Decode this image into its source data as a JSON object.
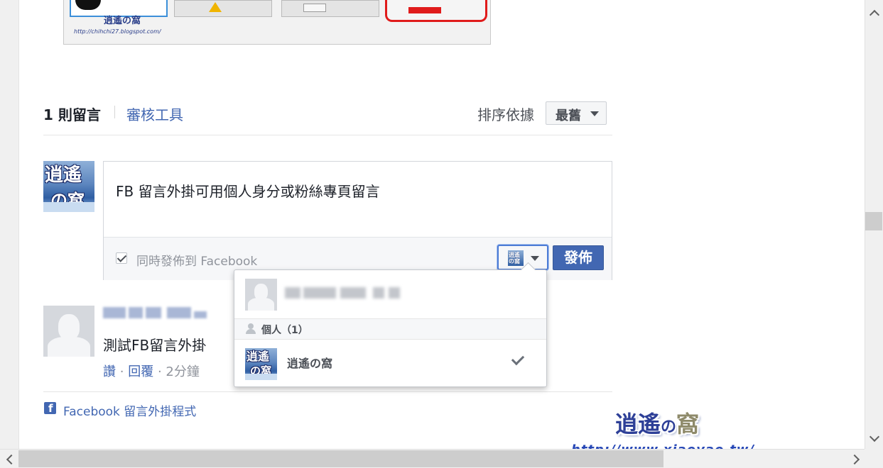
{
  "top_thumbnail": {
    "logo_text": "逍遙の窩",
    "url_text": "http://chihchi27.blogspot.com/"
  },
  "comments_header": {
    "count_label": "1 則留言",
    "moderation_link": "審核工具",
    "sort_label": "排序依據",
    "sort_value": "最舊"
  },
  "composer": {
    "avatar_line1": "逍遙",
    "avatar_line2": "の窩",
    "text": "FB 留言外掛可用個人身分或粉絲專頁留言",
    "share_checked": true,
    "share_label": "同時發佈到 Facebook",
    "identity_mini_text": "逍遙の窩",
    "post_button": "發佈"
  },
  "comment": {
    "text": "測試FB留言外掛",
    "like": "讚",
    "reply": "回覆",
    "dot": "·",
    "time": "2分鐘"
  },
  "footer": {
    "fb_icon_letter": "f",
    "plugin_link": "Facebook 留言外掛程式"
  },
  "identity_dropdown": {
    "section_label": "個人（1）",
    "page_name": "逍遙の窩",
    "selected": "逍遙の窩"
  },
  "watermark": {
    "title_a": "逍遙",
    "title_no": "の",
    "title_b": "窩",
    "url": "http://www.xiaoyao.tw/"
  },
  "colors": {
    "facebook_blue": "#4267b2",
    "border": "#d3d6db",
    "muted_text": "#90949c"
  },
  "icons": [
    "checkbox-icon",
    "chevron-down-icon",
    "person-icon",
    "checkmark-icon",
    "facebook-icon",
    "scroll-up-icon",
    "scroll-down-icon",
    "scroll-left-icon",
    "scroll-right-icon"
  ]
}
